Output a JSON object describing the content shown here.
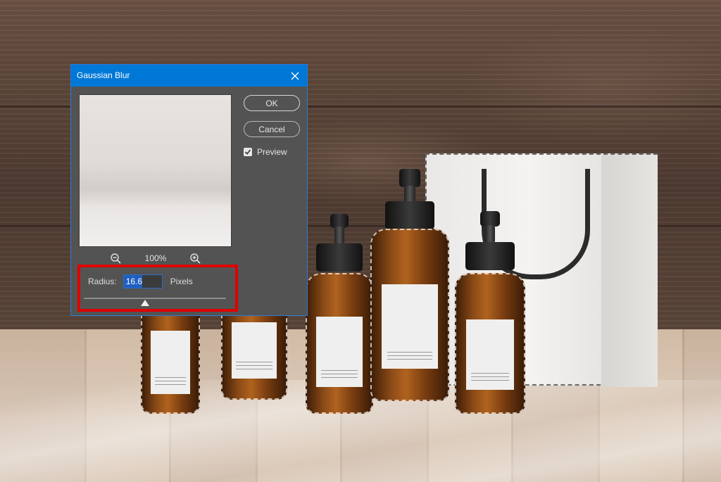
{
  "dialog": {
    "title": "Gaussian Blur",
    "ok_label": "OK",
    "cancel_label": "Cancel",
    "preview_label": "Preview",
    "preview_checked": true,
    "zoom_level": "100%",
    "radius": {
      "label": "Radius:",
      "value": "16.6",
      "unit": "Pixels",
      "slider_fraction": 0.43
    }
  },
  "colors": {
    "titlebar": "#0078d7",
    "dialog_bg": "#535353",
    "highlight": "#e00000"
  },
  "icons": {
    "close": "close-icon",
    "zoom_out": "zoom-out-icon",
    "zoom_in": "zoom-in-icon",
    "check": "check-icon"
  }
}
